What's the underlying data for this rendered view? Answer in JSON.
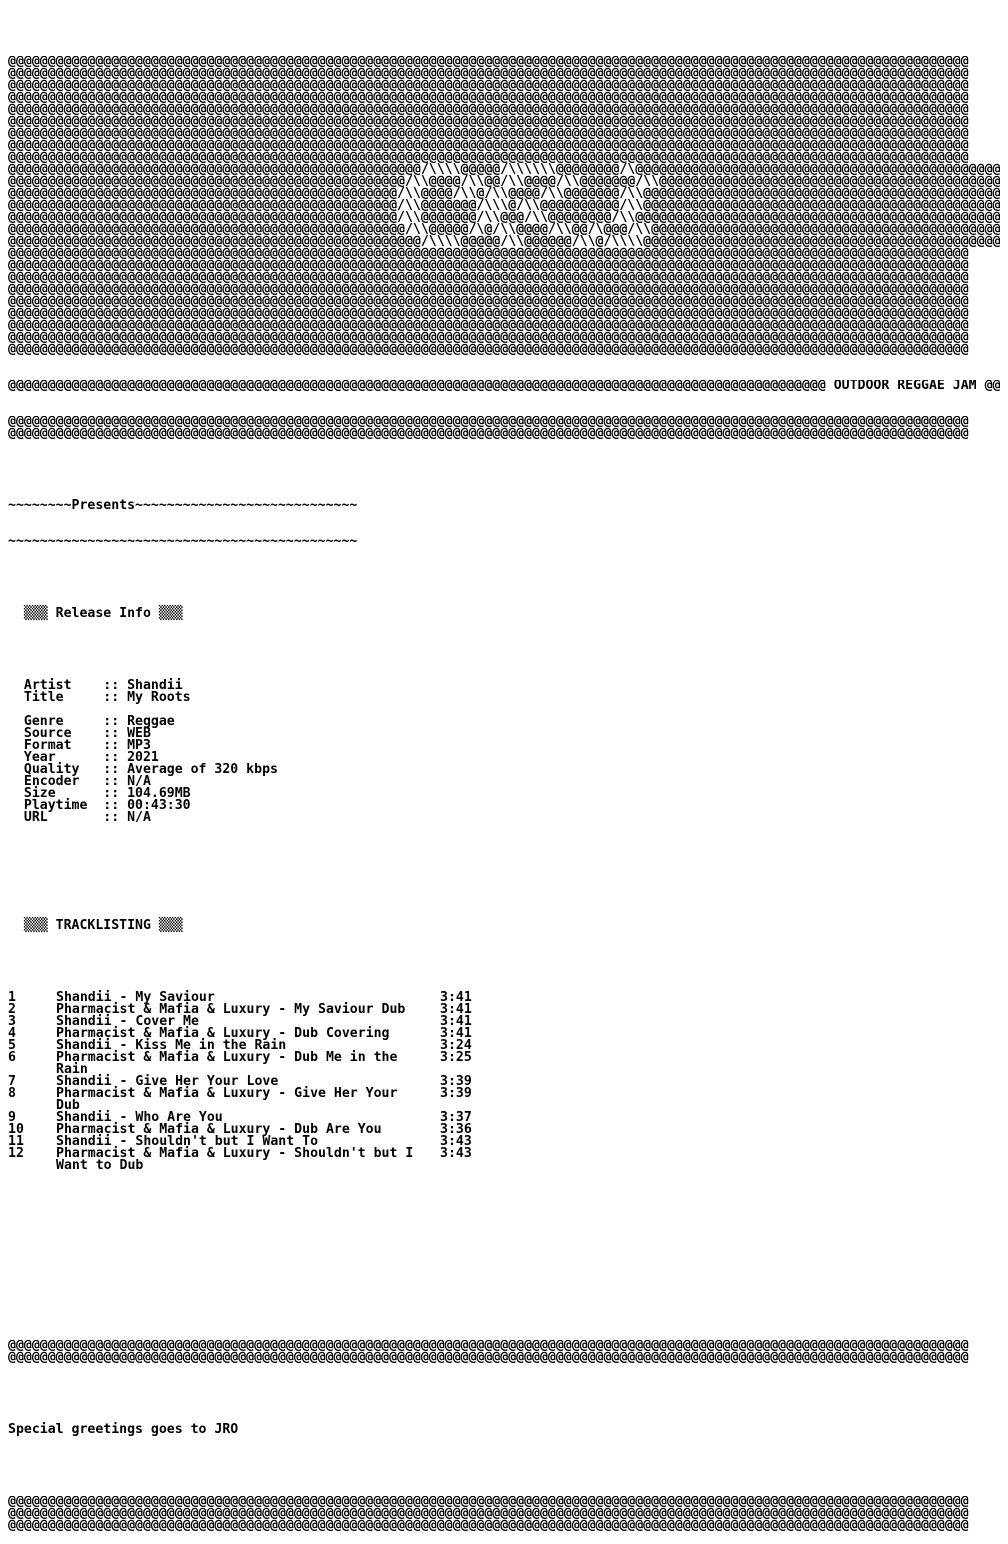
{
  "banner": {
    "lines": [
      "@@@@@@@@@@@@@@@@@@@@@@@@@@@@@@@@@@@@@@@@@@@@@@@@@@@@@@@@@@@@@@@@@@@@@@@@@@@@@@@@@@@@@@@@@@@@@@@@@@@@@@@@@@@@@@@@@@@@@@@@@",
      "@@@@@@@@@@@@@@@@@@@@@@@@@@@@@@@@@@@@@@@@@@@@@@@@@@@@@@@@@@@@@@@@@@@@@@@@@@@@@@@@@@@@@@@@@@@@@@@@@@@@@@@@@@@@@@@@@@@@@@@@@",
      "@@@@@@@@@@@@@@@@@@@@@@@@@@@@@@@@@@@@@@@@@@@@@@@@@@@@@@@@@@@@@@@@@@@@@@@@@@@@@@@@@@@@@@@@@@@@@@@@@@@@@@@@@@@@@@@@@@@@@@@@@",
      "@@@@@@@@@@@@@@@@@@@@@@@@@@@@@@@@@@@@@@@@@@@@@@@@@@@@@@@@@@@@@@@@@@@@@@@@@@@@@@@@@@@@@@@@@@@@@@@@@@@@@@@@@@@@@@@@@@@@@@@@@",
      "@@@@@@@@@@@@@@@@@@@@@@@@@@@@@@@@@@@@@@@@@@@@@@@@@@@@@@@@@@@@@@@@@@@@@@@@@@@@@@@@@@@@@@@@@@@@@@@@@@@@@@@@@@@@@@@@@@@@@@@@@",
      "@@@@@@@@@@@@@@@@@@@@@@@@@@@@@@@@@@@@@@@@@@@@@@@@@@@@@@@@@@@@@@@@@@@@@@@@@@@@@@@@@@@@@@@@@@@@@@@@@@@@@@@@@@@@@@@@@@@@@@@@@",
      "@@@@@@@@@@@@@@@@@@@@@@@@@@@@@@@@@@@@@@@@@@@@@@@@@@@@@@@@@@@@@@@@@@@@@@@@@@@@@@@@@@@@@@@@@@@@@@@@@@@@@@@@@@@@@@@@@@@@@@@@@",
      "@@@@@@@@@@@@@@@@@@@@@@@@@@@@@@@@@@@@@@@@@@@@@@@@@@@@@@@@@@@@@@@@@@@@@@@@@@@@@@@@@@@@@@@@@@@@@@@@@@@@@@@@@@@@@@@@@@@@@@@@@",
      "@@@@@@@@@@@@@@@@@@@@@@@@@@@@@@@@@@@@@@@@@@@@@@@@@@@@@@@@@@@@@@@@@@@@@@@@@@@@@@@@@@@@@@@@@@@@@@@@@@@@@@@@@@@@@@@@@@@@@@@@@",
      "@@@@@@@@@@@@@@@@@@@@@@@@@@@@@@@@@@@@@@@@@@@@@@@@@@@@/\\\\\\\\@@@@@/\\\\\\\\\\\\@@@@@@@@/\\@@@@@@@@@@@@@@@@@@@@@@@@@@@@@@@@@@@@@@@@@@@@@@@@@",
      "@@@@@@@@@@@@@@@@@@@@@@@@@@@@@@@@@@@@@@@@@@@@@@@@@@/\\\\@@@@/\\\\@@/\\\\@@@@/\\\\@@@@@@@/\\\\@@@@@@@@@@@@@@@@@@@@@@@@@@@@@@@@@@@@@@@@@@@@@@@@@@",
      "@@@@@@@@@@@@@@@@@@@@@@@@@@@@@@@@@@@@@@@@@@@@@@@@@/\\\\@@@@/\\\\@/\\\\@@@@/\\\\@@@@@@@/\\\\@@@@@@@@@@@@@@@@@@@@@@@@@@@@@@@@@@@@@@@@@@@@@@@@@@@",
      "@@@@@@@@@@@@@@@@@@@@@@@@@@@@@@@@@@@@@@@@@@@@@@@@@/\\\\@@@@@@@/\\\\\\@/\\\\@@@@@@@@@@/\\\\@@@@@@@@@@@@@@@@@@@@@@@@@@@@@@@@@@@@@@@@@@@@@@@@@@@@",
      "@@@@@@@@@@@@@@@@@@@@@@@@@@@@@@@@@@@@@@@@@@@@@@@@@/\\\\@@@@@@@/\\\\@@@/\\\\@@@@@@@@/\\\\@@@@@@@@@@@@@@@@@@@@@@@@@@@@@@@@@@@@@@@@@@@@@@@@@@@@",
      "@@@@@@@@@@@@@@@@@@@@@@@@@@@@@@@@@@@@@@@@@@@@@@@@@@/\\\\@@@@@/\\@/\\\\@@@@/\\\\@@/\\@@@/\\\\@@@@@@@@@@@@@@@@@@@@@@@@@@@@@@@@@@@@@@@@@@@@@@@@@@@@",
      "@@@@@@@@@@@@@@@@@@@@@@@@@@@@@@@@@@@@@@@@@@@@@@@@@@@@/\\\\\\\\@@@@@/\\\\@@@@@@/\\\\@/\\\\\\\\@@@@@@@@@@@@@@@@@@@@@@@@@@@@@@@@@@@@@@@@@@@@@@@@@@@@@@@@@",
      "@@@@@@@@@@@@@@@@@@@@@@@@@@@@@@@@@@@@@@@@@@@@@@@@@@@@@@@@@@@@@@@@@@@@@@@@@@@@@@@@@@@@@@@@@@@@@@@@@@@@@@@@@@@@@@@@@@@@@@@@@",
      "@@@@@@@@@@@@@@@@@@@@@@@@@@@@@@@@@@@@@@@@@@@@@@@@@@@@@@@@@@@@@@@@@@@@@@@@@@@@@@@@@@@@@@@@@@@@@@@@@@@@@@@@@@@@@@@@@@@@@@@@@",
      "@@@@@@@@@@@@@@@@@@@@@@@@@@@@@@@@@@@@@@@@@@@@@@@@@@@@@@@@@@@@@@@@@@@@@@@@@@@@@@@@@@@@@@@@@@@@@@@@@@@@@@@@@@@@@@@@@@@@@@@@@",
      "@@@@@@@@@@@@@@@@@@@@@@@@@@@@@@@@@@@@@@@@@@@@@@@@@@@@@@@@@@@@@@@@@@@@@@@@@@@@@@@@@@@@@@@@@@@@@@@@@@@@@@@@@@@@@@@@@@@@@@@@@",
      "@@@@@@@@@@@@@@@@@@@@@@@@@@@@@@@@@@@@@@@@@@@@@@@@@@@@@@@@@@@@@@@@@@@@@@@@@@@@@@@@@@@@@@@@@@@@@@@@@@@@@@@@@@@@@@@@@@@@@@@@@",
      "@@@@@@@@@@@@@@@@@@@@@@@@@@@@@@@@@@@@@@@@@@@@@@@@@@@@@@@@@@@@@@@@@@@@@@@@@@@@@@@@@@@@@@@@@@@@@@@@@@@@@@@@@@@@@@@@@@@@@@@@@",
      "@@@@@@@@@@@@@@@@@@@@@@@@@@@@@@@@@@@@@@@@@@@@@@@@@@@@@@@@@@@@@@@@@@@@@@@@@@@@@@@@@@@@@@@@@@@@@@@@@@@@@@@@@@@@@@@@@@@@@@@@@",
      "@@@@@@@@@@@@@@@@@@@@@@@@@@@@@@@@@@@@@@@@@@@@@@@@@@@@@@@@@@@@@@@@@@@@@@@@@@@@@@@@@@@@@@@@@@@@@@@@@@@@@@@@@@@@@@@@@@@@@@@@@",
      "@@@@@@@@@@@@@@@@@@@@@@@@@@@@@@@@@@@@@@@@@@@@@@@@@@@@@@@@@@@@@@@@@@@@@@@@@@@@@@@@@@@@@@@@@@@@@@@@@@@@@@@@@@@@@@@@@@@@@@@@@"
    ],
    "brand_line": "@@@@@@@@@@@@@@@@@@@@@@@@@@@@@@@@@@@@@@@@@@@@@@@@@@@@@@@@@@@@@@@@@@@@@@@@@@@@@@@@@@@@@@@@@@@@@@@@@@@@@@@ OUTDOOR REGGAE JAM @@@@@@@@@@@@@@@@@@@@@@@@@@",
    "after_brand": [
      "@@@@@@@@@@@@@@@@@@@@@@@@@@@@@@@@@@@@@@@@@@@@@@@@@@@@@@@@@@@@@@@@@@@@@@@@@@@@@@@@@@@@@@@@@@@@@@@@@@@@@@@@@@@@@@@@@@@@@@@@@",
      "@@@@@@@@@@@@@@@@@@@@@@@@@@@@@@@@@@@@@@@@@@@@@@@@@@@@@@@@@@@@@@@@@@@@@@@@@@@@@@@@@@@@@@@@@@@@@@@@@@@@@@@@@@@@@@@@@@@@@@@@@"
    ]
  },
  "presents": {
    "line1": "~~~~~~~~Presents~~~~~~~~~~~~~~~~~~~~~~~~~~~~",
    "line2": "~~~~~~~~~~~~~~~~~~~~~~~~~~~~~~~~~~~~~~~~~~~~"
  },
  "release_info": {
    "heading": "  ▒▒▒ Release Info ▒▒▒",
    "fields": [
      {
        "label": "Artist",
        "value": "Shandii"
      },
      {
        "label": "Title",
        "value": "My Roots"
      },
      {
        "label": "",
        "value": ""
      },
      {
        "label": "Genre",
        "value": "Reggae"
      },
      {
        "label": "Source",
        "value": "WEB"
      },
      {
        "label": "Format",
        "value": "MP3"
      },
      {
        "label": "Year",
        "value": "2021"
      },
      {
        "label": "Quality",
        "value": "Average of 320 kbps"
      },
      {
        "label": "Encoder",
        "value": "N/A"
      },
      {
        "label": "Size",
        "value": "104.69MB"
      },
      {
        "label": "Playtime",
        "value": "00:43:30"
      },
      {
        "label": "URL",
        "value": "N/A"
      }
    ],
    "separator": "::"
  },
  "tracklisting": {
    "heading": "  ▒▒▒ TRACKLISTING ▒▒▒",
    "tracks": [
      {
        "num": "1",
        "name": [
          "Shandii - My Saviour"
        ],
        "time": "3:41"
      },
      {
        "num": "2",
        "name": [
          "Pharmacist & Mafia & Luxury - My Saviour Dub"
        ],
        "time": "3:41"
      },
      {
        "num": "3",
        "name": [
          "Shandii - Cover Me"
        ],
        "time": "3:41"
      },
      {
        "num": "4",
        "name": [
          "Pharmacist & Mafia & Luxury - Dub Covering"
        ],
        "time": "3:41"
      },
      {
        "num": "5",
        "name": [
          "Shandii - Kiss Me in the Rain"
        ],
        "time": "3:24"
      },
      {
        "num": "6",
        "name": [
          "Pharmacist & Mafia & Luxury - Dub Me in the",
          "Rain"
        ],
        "time": "3:25"
      },
      {
        "num": "7",
        "name": [
          "Shandii - Give Her Your Love"
        ],
        "time": "3:39"
      },
      {
        "num": "8",
        "name": [
          "Pharmacist & Mafia & Luxury - Give Her Your",
          "Dub"
        ],
        "time": "3:39"
      },
      {
        "num": "9",
        "name": [
          "Shandii - Who Are You"
        ],
        "time": "3:37"
      },
      {
        "num": "10",
        "name": [
          "Pharmacist & Mafia & Luxury - Dub Are You"
        ],
        "time": "3:36"
      },
      {
        "num": "11",
        "name": [
          "Shandii - Shouldn't but I Want To"
        ],
        "time": "3:43"
      },
      {
        "num": "12",
        "name": [
          "Pharmacist & Mafia & Luxury - Shouldn't but I",
          "Want to Dub"
        ],
        "time": "3:43"
      }
    ]
  },
  "footer": {
    "rule_top": [
      "@@@@@@@@@@@@@@@@@@@@@@@@@@@@@@@@@@@@@@@@@@@@@@@@@@@@@@@@@@@@@@@@@@@@@@@@@@@@@@@@@@@@@@@@@@@@@@@@@@@@@@@@@@@@@@@@@@@@@@@@@",
      "@@@@@@@@@@@@@@@@@@@@@@@@@@@@@@@@@@@@@@@@@@@@@@@@@@@@@@@@@@@@@@@@@@@@@@@@@@@@@@@@@@@@@@@@@@@@@@@@@@@@@@@@@@@@@@@@@@@@@@@@@"
    ],
    "greeting": "Special greetings goes to JRO",
    "rule_bottom": [
      "@@@@@@@@@@@@@@@@@@@@@@@@@@@@@@@@@@@@@@@@@@@@@@@@@@@@@@@@@@@@@@@@@@@@@@@@@@@@@@@@@@@@@@@@@@@@@@@@@@@@@@@@@@@@@@@@@@@@@@@@@",
      "@@@@@@@@@@@@@@@@@@@@@@@@@@@@@@@@@@@@@@@@@@@@@@@@@@@@@@@@@@@@@@@@@@@@@@@@@@@@@@@@@@@@@@@@@@@@@@@@@@@@@@@@@@@@@@@@@@@@@@@@@",
      "@@@@@@@@@@@@@@@@@@@@@@@@@@@@@@@@@@@@@@@@@@@@@@@@@@@@@@@@@@@@@@@@@@@@@@@@@@@@@@@@@@@@@@@@@@@@@@@@@@@@@@@@@@@@@@@@@@@@@@@@@"
    ]
  }
}
